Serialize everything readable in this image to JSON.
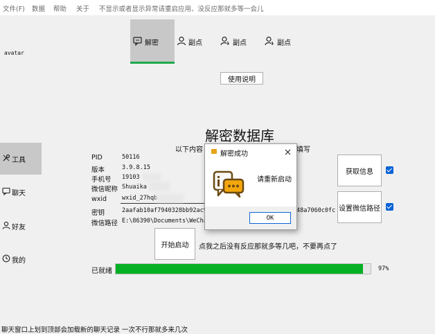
{
  "menu": {
    "file": "文件(F)",
    "data": "数据",
    "help": "帮助",
    "about": "关于",
    "notice": "不显示或者显示异常请重启应用、没反应那就多等一会儿"
  },
  "avatar_label": "avatar",
  "tabs": [
    {
      "label": "解密",
      "icon": "chat-icon"
    },
    {
      "label": "副点",
      "icon": "user-icon"
    },
    {
      "label": "副点",
      "icon": "user-key-icon"
    },
    {
      "label": "副点",
      "icon": "user-key-icon"
    }
  ],
  "help_button": "使用说明",
  "heading": "解密数据库",
  "subheading_left": "以下内容",
  "subheading_right": "填写",
  "sidebar": [
    {
      "label": "工具",
      "icon": "tools-icon"
    },
    {
      "label": "聊天",
      "icon": "chat-icon"
    },
    {
      "label": "好友",
      "icon": "user-icon"
    },
    {
      "label": "我的",
      "icon": "clock-icon"
    }
  ],
  "info": {
    "pid_label": "PID",
    "pid": "50116",
    "version_label": "版本",
    "version": "3.9.8.15",
    "phone_label": "手机号",
    "phone": "19103",
    "nickname_label": "微信昵称",
    "nickname": "Shuaika",
    "wxid_label": "wxid",
    "wxid": "wxid_27hqb",
    "key_label": "密钥",
    "key": "2aafab10af7940328bb92ac9d",
    "key_tail": "48a7060c0fc",
    "path_label": "微信路径",
    "path": "E:\\86390\\Documents\\WeChat"
  },
  "buttons": {
    "get_info": "获取信息",
    "set_path": "设置微信路径",
    "start": "开始启动"
  },
  "start_hint": "点我之后没有反应那就多等几吧，不要再点了",
  "progress": {
    "label": "已就绪",
    "percent": 97,
    "text": "97%"
  },
  "dialog": {
    "title": "解密成功",
    "message": "请重新启动",
    "ok": "OK"
  },
  "footer": "聊天窗口上划到顶部会加载新的聊天记录 一次不行那就多来几次",
  "colors": {
    "accent_green": "#1ea84a",
    "progress_green": "#06b025",
    "checkbox_blue": "#0a64d6"
  }
}
